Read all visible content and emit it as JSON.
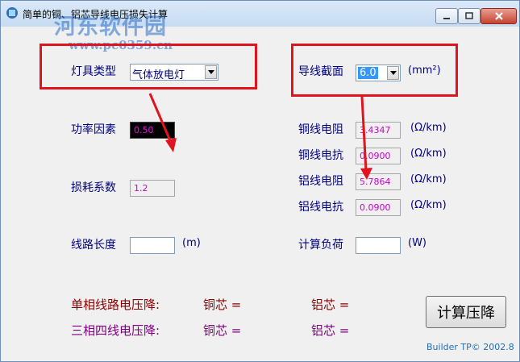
{
  "window": {
    "title": "简单的铜、铝芯导线电压损失计算",
    "watermark_cn": "河东软件园",
    "watermark_url": "www.pc0359.cn"
  },
  "form": {
    "lamp_type_label": "灯具类型",
    "lamp_type_value": "气体放电灯",
    "section_label": "导线截面",
    "section_value": "6.0",
    "section_unit": "(mm²)",
    "power_factor_label": "功率因素",
    "power_factor_value": "0.50",
    "loss_coef_label": "损耗系数",
    "loss_coef_value": "1.2",
    "line_length_label": "线路长度",
    "line_length_value": "",
    "line_length_unit": "(m)",
    "load_label": "计算负荷",
    "load_value": "",
    "load_unit": "(W)",
    "cu_resistance_label": "铜线电阻",
    "cu_resistance_value": "3.4347",
    "cu_reactance_label": "铜线电抗",
    "cu_reactance_value": "0.0900",
    "al_resistance_label": "铝线电阻",
    "al_resistance_value": "5.7864",
    "al_reactance_label": "铝线电抗",
    "al_reactance_value": "0.0900",
    "ohm_per_km": "(Ω/km)"
  },
  "results": {
    "single_phase_label": "单相线路电压降:",
    "three_phase_label": "三相四线电压降:",
    "copper_label": "铜芯 =",
    "aluminum_label": "铝芯 ="
  },
  "buttons": {
    "calculate": "计算压降"
  },
  "footer": {
    "credit": "Builder TP© 2002.8"
  },
  "colors": {
    "annotation_red": "#e0141e",
    "label_blue": "#000080",
    "value_magenta": "#cc00cc"
  }
}
